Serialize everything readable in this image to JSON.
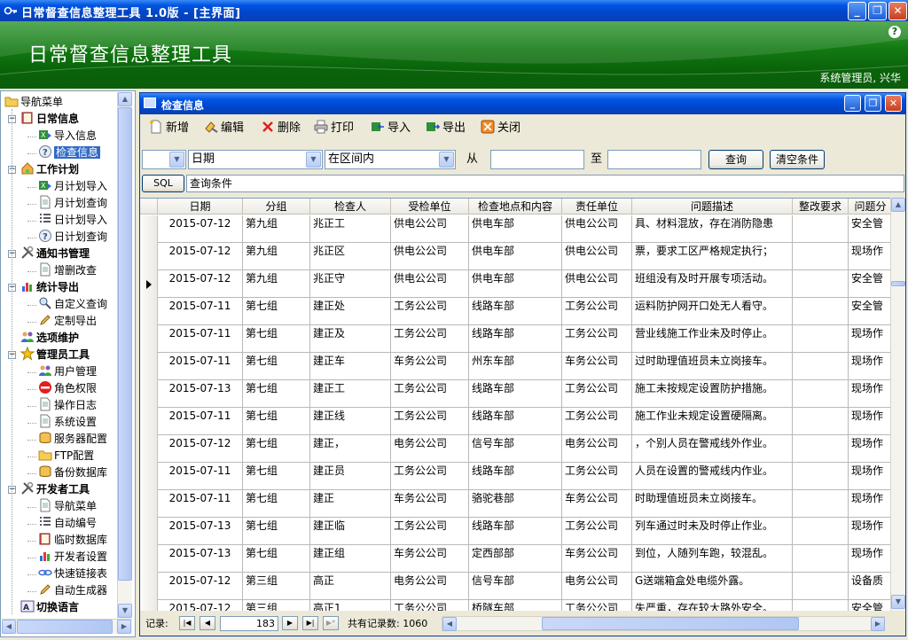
{
  "window": {
    "title": "日常督查信息整理工具 1.0版 - [主界面]",
    "controls": {
      "minimize": "_",
      "restore": "❐",
      "close": "✕"
    }
  },
  "banner": {
    "app_name": "日常督查信息整理工具",
    "help": "?",
    "user": "系统管理员, 兴华"
  },
  "nav": {
    "root": "导航菜单",
    "items": [
      {
        "label": "日常信息",
        "level": 1,
        "icon": "book-icon",
        "expander": "−"
      },
      {
        "label": "导入信息",
        "level": 2,
        "icon": "excel-import-icon"
      },
      {
        "label": "检查信息",
        "level": 2,
        "icon": "help-icon",
        "selected": true
      },
      {
        "label": "工作计划",
        "level": 1,
        "icon": "house-icon",
        "expander": "−"
      },
      {
        "label": "月计划导入",
        "level": 2,
        "icon": "excel-import-icon"
      },
      {
        "label": "月计划查询",
        "level": 2,
        "icon": "document-icon"
      },
      {
        "label": "日计划导入",
        "level": 2,
        "icon": "list-icon"
      },
      {
        "label": "日计划查询",
        "level": 2,
        "icon": "help-icon"
      },
      {
        "label": "通知书管理",
        "level": 1,
        "icon": "tools-icon",
        "expander": "−"
      },
      {
        "label": "增删改查",
        "level": 2,
        "icon": "document-icon"
      },
      {
        "label": "统计导出",
        "level": 1,
        "icon": "chart-icon",
        "expander": "−"
      },
      {
        "label": "自定义查询",
        "level": 2,
        "icon": "search-icon"
      },
      {
        "label": "定制导出",
        "level": 2,
        "icon": "pen-icon"
      },
      {
        "label": "选项维护",
        "level": 1,
        "icon": "users-icon",
        "expander": ""
      },
      {
        "label": "管理员工具",
        "level": 1,
        "icon": "star-icon",
        "expander": "−"
      },
      {
        "label": "用户管理",
        "level": 2,
        "icon": "users-icon"
      },
      {
        "label": "角色权限",
        "level": 2,
        "icon": "no-entry-icon"
      },
      {
        "label": "操作日志",
        "level": 2,
        "icon": "document-icon"
      },
      {
        "label": "系统设置",
        "level": 2,
        "icon": "document-icon"
      },
      {
        "label": "服务器配置",
        "level": 2,
        "icon": "database-icon"
      },
      {
        "label": "FTP配置",
        "level": 2,
        "icon": "folder-icon"
      },
      {
        "label": "备份数据库",
        "level": 2,
        "icon": "database-icon"
      },
      {
        "label": "开发者工具",
        "level": 1,
        "icon": "tools-icon",
        "expander": "−"
      },
      {
        "label": "导航菜单",
        "level": 2,
        "icon": "document-icon"
      },
      {
        "label": "自动编号",
        "level": 2,
        "icon": "list-icon"
      },
      {
        "label": "临时数据库",
        "level": 2,
        "icon": "book-icon"
      },
      {
        "label": "开发者设置",
        "level": 2,
        "icon": "chart-icon"
      },
      {
        "label": "快速链接表",
        "level": 2,
        "icon": "link-icon"
      },
      {
        "label": "自动生成器",
        "level": 2,
        "icon": "pen-icon"
      },
      {
        "label": "切换语言",
        "level": 1,
        "icon": "language-icon",
        "expander": ""
      }
    ]
  },
  "child": {
    "title": "检查信息",
    "toolbar": [
      {
        "label": "新增",
        "icon": "new-icon"
      },
      {
        "label": "编辑",
        "icon": "edit-icon"
      },
      {
        "label": "删除",
        "icon": "delete-icon"
      },
      {
        "label": "打印",
        "icon": "print-icon"
      },
      {
        "label": "导入",
        "icon": "import-icon"
      },
      {
        "label": "导出",
        "icon": "export-icon"
      },
      {
        "label": "关闭",
        "icon": "close-icon"
      }
    ],
    "filter": {
      "logic_value": "",
      "field_value": "日期",
      "operator_value": "在区间内",
      "from_label": "从",
      "from_value": "",
      "to_label": "至",
      "to_value": "",
      "query_button": "查询",
      "clear_button": "清空条件"
    },
    "sql": {
      "button": "SQL",
      "condition": "查询条件"
    },
    "grid": {
      "columns": [
        "日期",
        "分组",
        "检查人",
        "受检单位",
        "检查地点和内容",
        "责任单位",
        "问题描述",
        "整改要求",
        "问题分"
      ],
      "rows": [
        [
          "2015-07-12",
          "第九组",
          "兆正工",
          "供电公公司",
          "供电车部",
          "供电公公司",
          "具、材料混放，存在消防隐患",
          "",
          "安全管"
        ],
        [
          "2015-07-12",
          "第九组",
          "兆正区",
          "供电公公司",
          "供电车部",
          "供电公公司",
          "票，要求工区严格规定执行；",
          "",
          "现场作"
        ],
        [
          "2015-07-12",
          "第九组",
          "兆正守",
          "供电公公司",
          "供电车部",
          "供电公公司",
          "班组没有及时开展专项活动。",
          "",
          "安全管"
        ],
        [
          "2015-07-11",
          "第七组",
          "建正处",
          "工务公公司",
          "线路车部",
          "工务公公司",
          "运料防护网开口处无人看守。",
          "",
          "安全管"
        ],
        [
          "2015-07-11",
          "第七组",
          "建正及",
          "工务公公司",
          "线路车部",
          "工务公公司",
          "营业线施工作业未及时停止。",
          "",
          "现场作"
        ],
        [
          "2015-07-11",
          "第七组",
          "建正车",
          "车务公公司",
          "州东车部",
          "车务公公司",
          "过时助理值班员未立岗接车。",
          "",
          "现场作"
        ],
        [
          "2015-07-13",
          "第七组",
          "建正工",
          "工务公公司",
          "线路车部",
          "工务公公司",
          "施工未按规定设置防护措施。",
          "",
          "现场作"
        ],
        [
          "2015-07-11",
          "第七组",
          "建正线",
          "工务公公司",
          "线路车部",
          "工务公公司",
          "施工作业未规定设置硬隔离。",
          "",
          "现场作"
        ],
        [
          "2015-07-12",
          "第七组",
          "建正，",
          "电务公公司",
          "信号车部",
          "电务公公司",
          "，个别人员在警戒线外作业。",
          "",
          "现场作"
        ],
        [
          "2015-07-11",
          "第七组",
          "建正员",
          "工务公公司",
          "线路车部",
          "工务公公司",
          "人员在设置的警戒线内作业。",
          "",
          "现场作"
        ],
        [
          "2015-07-11",
          "第七组",
          "建正",
          "车务公公司",
          "骆驼巷部",
          "车务公公司",
          "时助理值班员未立岗接车。",
          "",
          "现场作"
        ],
        [
          "2015-07-13",
          "第七组",
          "建正临",
          "工务公公司",
          "线路车部",
          "工务公公司",
          "列车通过时未及时停止作业。",
          "",
          "现场作"
        ],
        [
          "2015-07-13",
          "第七组",
          "建正组",
          "车务公公司",
          "定西部部",
          "车务公公司",
          "到位，人随列车跑，较混乱。",
          "",
          "现场作"
        ],
        [
          "2015-07-12",
          "第三组",
          "高正",
          "电务公公司",
          "信号车部",
          "电务公公司",
          "G送端箱盒处电缆外露。",
          "",
          "设备质"
        ],
        [
          "2015-07-12",
          "第三组",
          "高正1",
          "工务公公司",
          "桥隧车部",
          "工务公公司",
          "失严重，存在较大路外安全。",
          "",
          "安全管"
        ]
      ],
      "current_row_index": 2
    },
    "status": {
      "record_label": "记录:",
      "current_record": "183",
      "total_label": "共有记录数: 1060"
    }
  },
  "colors": {
    "xp_blue": "#0054e3",
    "banner_green": "#137a13",
    "selection": "#316ac5"
  }
}
